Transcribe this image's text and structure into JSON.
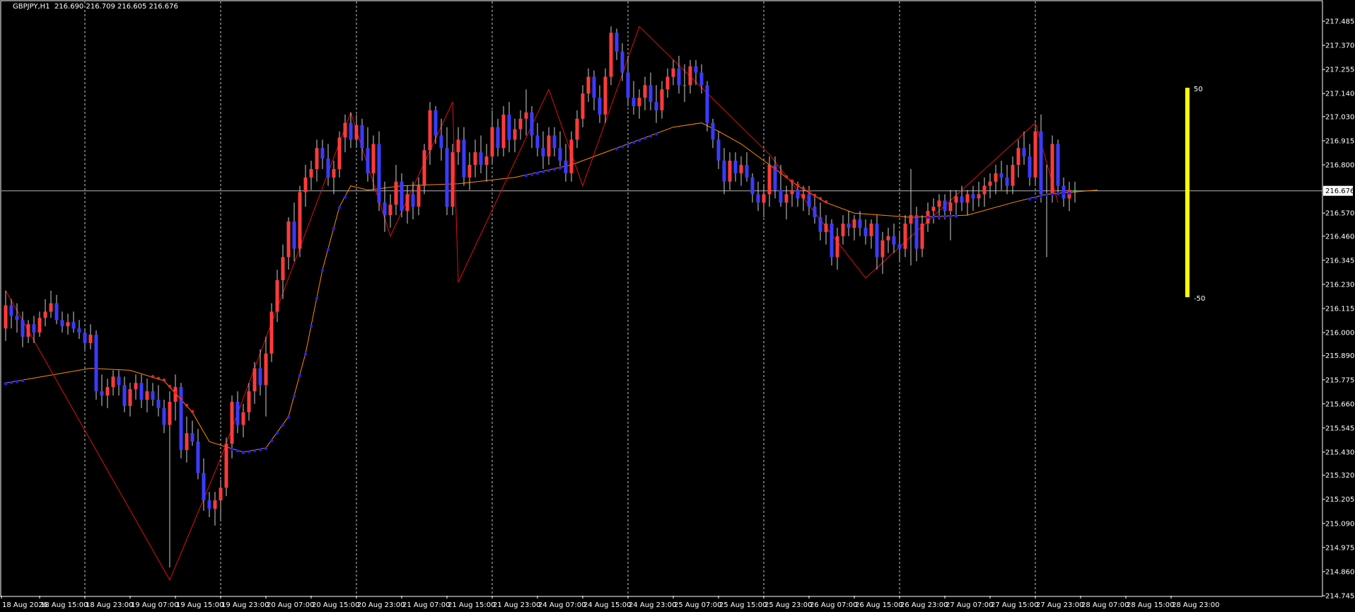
{
  "window": {
    "symbol": "GBPJPY,H1",
    "quote": "216.690 216.709 216.605 216.676"
  },
  "colors": {
    "background": "#000000",
    "foreground": "#ffffff",
    "grid": "#c8c8c8",
    "bull_candle": "#ff3b3b",
    "bear_candle": "#3b3bff",
    "doji_candle": "#00c000",
    "zigzag": "#e01010",
    "ma_line": "#ff8c00",
    "dot_up": "#2020ff",
    "dot_down": "#ff2020",
    "bid_line": "#b4b4b4",
    "gauge": "#ffff00"
  },
  "price_axis": {
    "labels": [
      "217.485",
      "217.370",
      "217.255",
      "217.140",
      "217.030",
      "216.915",
      "216.800",
      "216.570",
      "216.460",
      "216.345",
      "216.230",
      "216.115",
      "216.000",
      "215.890",
      "215.775",
      "215.660",
      "215.545",
      "215.430",
      "215.320",
      "215.205",
      "215.090",
      "214.975",
      "214.860",
      "214.745"
    ],
    "min": 214.745,
    "max": 217.485,
    "current_price": "216.676"
  },
  "time_axis": {
    "labels": [
      "18 Aug 2026",
      "18 Aug 15:00",
      "18 Aug 23:00",
      "19 Aug 07:00",
      "19 Aug 15:00",
      "19 Aug 23:00",
      "20 Aug 07:00",
      "20 Aug 15:00",
      "20 Aug 23:00",
      "21 Aug 07:00",
      "21 Aug 15:00",
      "21 Aug 23:00",
      "24 Aug 07:00",
      "24 Aug 15:00",
      "24 Aug 23:00",
      "25 Aug 07:00",
      "25 Aug 15:00",
      "25 Aug 23:00",
      "26 Aug 07:00",
      "26 Aug 15:00",
      "26 Aug 23:00",
      "27 Aug 07:00",
      "27 Aug 15:00",
      "27 Aug 23:00",
      "28 Aug 07:00",
      "28 Aug 15:00",
      "28 Aug 23:00"
    ]
  },
  "gauge": {
    "top_label": "50",
    "bottom_label": "-50"
  },
  "chart_data": {
    "type": "candlestick",
    "symbol": "GBPJPY",
    "timeframe": "H1",
    "candle_interval": "1h",
    "ohlc": [
      [
        216.02,
        216.2,
        215.96,
        216.13
      ],
      [
        216.13,
        216.16,
        216.02,
        216.08
      ],
      [
        216.08,
        216.14,
        216.0,
        216.06
      ],
      [
        216.06,
        216.1,
        215.93,
        215.98
      ],
      [
        215.98,
        216.06,
        215.95,
        216.04
      ],
      [
        216.04,
        216.08,
        215.95,
        216.0
      ],
      [
        216.0,
        216.1,
        215.98,
        216.07
      ],
      [
        216.07,
        216.16,
        216.03,
        216.1
      ],
      [
        216.1,
        216.2,
        216.07,
        216.14
      ],
      [
        216.14,
        216.18,
        216.04,
        216.06
      ],
      [
        216.06,
        216.1,
        216.0,
        216.03
      ],
      [
        216.03,
        216.09,
        215.99,
        216.05
      ],
      [
        216.05,
        216.1,
        216.0,
        216.02
      ],
      [
        216.02,
        216.06,
        215.97,
        216.0
      ],
      [
        216.0,
        216.02,
        215.92,
        215.95
      ],
      [
        215.95,
        216.04,
        215.92,
        215.99
      ],
      [
        215.99,
        216.01,
        215.68,
        215.72
      ],
      [
        215.72,
        215.8,
        215.65,
        215.7
      ],
      [
        215.7,
        215.78,
        215.64,
        215.74
      ],
      [
        215.74,
        215.82,
        215.7,
        215.79
      ],
      [
        215.79,
        215.82,
        215.7,
        215.75
      ],
      [
        215.75,
        215.79,
        215.62,
        215.65
      ],
      [
        215.65,
        215.76,
        215.6,
        215.73
      ],
      [
        215.73,
        215.8,
        215.68,
        215.76
      ],
      [
        215.76,
        215.8,
        215.64,
        215.68
      ],
      [
        215.68,
        215.78,
        215.62,
        215.72
      ],
      [
        215.72,
        215.76,
        215.65,
        215.68
      ],
      [
        215.68,
        215.75,
        215.6,
        215.64
      ],
      [
        215.64,
        215.68,
        215.52,
        215.56
      ],
      [
        215.56,
        215.72,
        214.88,
        215.67
      ],
      [
        215.67,
        215.8,
        215.58,
        215.74
      ],
      [
        215.74,
        215.76,
        215.4,
        215.44
      ],
      [
        215.44,
        215.6,
        215.38,
        215.52
      ],
      [
        215.52,
        215.58,
        215.46,
        215.48
      ],
      [
        215.48,
        215.54,
        215.3,
        215.33
      ],
      [
        215.33,
        215.4,
        215.15,
        215.2
      ],
      [
        215.2,
        215.24,
        215.12,
        215.16
      ],
      [
        215.16,
        215.24,
        215.08,
        215.2
      ],
      [
        215.2,
        215.3,
        215.1,
        215.26
      ],
      [
        215.26,
        215.5,
        215.22,
        215.47
      ],
      [
        215.47,
        215.7,
        215.4,
        215.67
      ],
      [
        215.67,
        215.72,
        215.52,
        215.56
      ],
      [
        215.56,
        215.66,
        215.5,
        215.62
      ],
      [
        215.62,
        215.76,
        215.58,
        215.72
      ],
      [
        215.72,
        215.86,
        215.66,
        215.83
      ],
      [
        215.83,
        215.92,
        215.7,
        215.75
      ],
      [
        215.75,
        215.98,
        215.6,
        215.9
      ],
      [
        215.9,
        216.14,
        215.86,
        216.1
      ],
      [
        216.1,
        216.3,
        216.05,
        216.25
      ],
      [
        216.25,
        216.42,
        216.16,
        216.36
      ],
      [
        216.36,
        216.55,
        216.3,
        216.53
      ],
      [
        216.53,
        216.62,
        216.34,
        216.4
      ],
      [
        216.4,
        216.7,
        216.36,
        216.67
      ],
      [
        216.67,
        216.8,
        216.6,
        216.74
      ],
      [
        216.74,
        216.82,
        216.68,
        216.78
      ],
      [
        216.78,
        216.92,
        216.72,
        216.88
      ],
      [
        216.88,
        216.92,
        216.78,
        216.83
      ],
      [
        216.83,
        216.9,
        216.7,
        216.74
      ],
      [
        216.74,
        216.82,
        216.66,
        216.78
      ],
      [
        216.78,
        216.96,
        216.74,
        216.93
      ],
      [
        216.93,
        217.04,
        216.86,
        217.0
      ],
      [
        217.0,
        217.05,
        216.88,
        216.92
      ],
      [
        216.92,
        217.04,
        216.88,
        216.99
      ],
      [
        216.99,
        217.02,
        216.82,
        216.88
      ],
      [
        216.88,
        216.98,
        216.72,
        216.76
      ],
      [
        216.76,
        216.94,
        216.68,
        216.9
      ],
      [
        216.9,
        216.96,
        216.58,
        216.62
      ],
      [
        216.62,
        216.72,
        216.48,
        216.56
      ],
      [
        216.56,
        216.66,
        216.5,
        216.61
      ],
      [
        216.61,
        216.8,
        216.56,
        216.72
      ],
      [
        216.72,
        216.76,
        216.55,
        216.58
      ],
      [
        216.58,
        216.7,
        216.52,
        216.66
      ],
      [
        216.66,
        216.72,
        216.54,
        216.6
      ],
      [
        216.6,
        216.74,
        216.56,
        216.7
      ],
      [
        216.7,
        216.9,
        216.66,
        216.87
      ],
      [
        216.87,
        217.1,
        216.8,
        217.06
      ],
      [
        217.06,
        217.08,
        216.9,
        216.94
      ],
      [
        216.94,
        217.02,
        216.82,
        216.88
      ],
      [
        216.88,
        216.98,
        216.56,
        216.6
      ],
      [
        216.6,
        216.9,
        216.56,
        216.86
      ],
      [
        216.86,
        216.98,
        216.8,
        216.92
      ],
      [
        216.92,
        216.98,
        216.7,
        216.74
      ],
      [
        216.74,
        216.86,
        216.68,
        216.8
      ],
      [
        216.8,
        216.92,
        216.74,
        216.86
      ],
      [
        216.86,
        216.94,
        216.76,
        216.8
      ],
      [
        216.8,
        216.9,
        216.72,
        216.84
      ],
      [
        216.84,
        217.06,
        216.8,
        216.98
      ],
      [
        216.98,
        217.02,
        216.84,
        216.88
      ],
      [
        216.88,
        217.08,
        216.84,
        217.04
      ],
      [
        217.04,
        217.1,
        216.86,
        216.92
      ],
      [
        216.92,
        217.02,
        216.86,
        216.97
      ],
      [
        216.97,
        217.06,
        216.92,
        217.02
      ],
      [
        217.02,
        217.16,
        216.94,
        217.05
      ],
      [
        217.05,
        217.08,
        216.88,
        216.94
      ],
      [
        216.94,
        217.0,
        216.84,
        216.88
      ],
      [
        216.88,
        216.96,
        216.78,
        216.84
      ],
      [
        216.84,
        216.98,
        216.8,
        216.94
      ],
      [
        216.94,
        216.98,
        216.84,
        216.88
      ],
      [
        216.88,
        216.96,
        216.78,
        216.82
      ],
      [
        216.82,
        216.9,
        216.72,
        216.76
      ],
      [
        216.76,
        216.96,
        216.72,
        216.92
      ],
      [
        216.92,
        217.06,
        216.88,
        217.02
      ],
      [
        217.02,
        217.18,
        216.98,
        217.14
      ],
      [
        217.14,
        217.26,
        217.1,
        217.22
      ],
      [
        217.22,
        217.25,
        217.06,
        217.12
      ],
      [
        217.12,
        217.18,
        217.0,
        217.04
      ],
      [
        217.04,
        217.26,
        217.0,
        217.22
      ],
      [
        217.22,
        217.46,
        217.18,
        217.43
      ],
      [
        217.43,
        217.45,
        217.3,
        217.34
      ],
      [
        217.34,
        217.38,
        217.2,
        217.24
      ],
      [
        217.24,
        217.32,
        217.08,
        217.12
      ],
      [
        217.12,
        217.2,
        217.04,
        217.08
      ],
      [
        217.08,
        217.16,
        217.02,
        217.12
      ],
      [
        217.12,
        217.22,
        217.06,
        217.18
      ],
      [
        217.18,
        217.24,
        217.06,
        217.1
      ],
      [
        217.1,
        217.18,
        217.0,
        217.06
      ],
      [
        217.06,
        217.2,
        217.02,
        217.16
      ],
      [
        217.16,
        217.26,
        217.12,
        217.22
      ],
      [
        217.22,
        217.3,
        217.18,
        217.26
      ],
      [
        217.26,
        217.32,
        217.14,
        217.18
      ],
      [
        217.18,
        217.28,
        217.1,
        217.18
      ],
      [
        217.18,
        217.3,
        217.14,
        217.27
      ],
      [
        217.27,
        217.3,
        217.18,
        217.24
      ],
      [
        217.24,
        217.28,
        217.14,
        217.18
      ],
      [
        217.18,
        217.2,
        216.96,
        217.0
      ],
      [
        217.0,
        217.02,
        216.88,
        216.92
      ],
      [
        216.92,
        216.96,
        216.78,
        216.82
      ],
      [
        216.82,
        216.88,
        216.66,
        216.72
      ],
      [
        216.72,
        216.86,
        216.68,
        216.82
      ],
      [
        216.82,
        216.86,
        216.72,
        216.76
      ],
      [
        216.76,
        216.84,
        216.7,
        216.8
      ],
      [
        216.8,
        216.86,
        216.72,
        216.74
      ],
      [
        216.74,
        216.76,
        216.62,
        216.66
      ],
      [
        216.66,
        216.72,
        216.58,
        216.62
      ],
      [
        216.62,
        216.7,
        216.55,
        216.66
      ],
      [
        216.66,
        216.84,
        216.6,
        216.8
      ],
      [
        216.8,
        216.84,
        216.64,
        216.68
      ],
      [
        216.68,
        216.8,
        216.6,
        216.62
      ],
      [
        216.62,
        216.7,
        216.54,
        216.66
      ],
      [
        216.66,
        216.72,
        216.6,
        216.68
      ],
      [
        216.68,
        216.72,
        216.6,
        216.64
      ],
      [
        216.64,
        216.7,
        216.58,
        216.66
      ],
      [
        216.66,
        216.7,
        216.56,
        216.6
      ],
      [
        216.6,
        216.66,
        216.52,
        216.55
      ],
      [
        216.55,
        216.62,
        216.44,
        216.48
      ],
      [
        216.48,
        216.56,
        216.42,
        216.52
      ],
      [
        216.52,
        216.54,
        216.32,
        216.36
      ],
      [
        216.36,
        216.5,
        216.3,
        216.46
      ],
      [
        216.46,
        216.56,
        216.42,
        216.52
      ],
      [
        216.52,
        216.58,
        216.46,
        216.5
      ],
      [
        216.5,
        216.56,
        216.44,
        216.54
      ],
      [
        216.54,
        216.58,
        216.46,
        216.5
      ],
      [
        216.5,
        216.54,
        216.42,
        216.46
      ],
      [
        216.46,
        216.54,
        216.4,
        216.52
      ],
      [
        216.52,
        216.56,
        216.3,
        216.36
      ],
      [
        216.36,
        216.48,
        216.28,
        216.44
      ],
      [
        216.44,
        216.5,
        216.38,
        216.46
      ],
      [
        216.46,
        216.52,
        216.38,
        216.42
      ],
      [
        216.42,
        216.48,
        216.34,
        216.4
      ],
      [
        216.4,
        216.56,
        216.36,
        216.52
      ],
      [
        216.52,
        216.78,
        216.32,
        216.56
      ],
      [
        216.56,
        216.6,
        216.34,
        216.4
      ],
      [
        216.4,
        216.56,
        216.36,
        216.52
      ],
      [
        216.52,
        216.62,
        216.48,
        216.58
      ],
      [
        216.58,
        216.64,
        216.52,
        216.6
      ],
      [
        216.6,
        216.66,
        216.54,
        216.63
      ],
      [
        216.63,
        216.66,
        216.54,
        216.58
      ],
      [
        216.58,
        216.68,
        216.44,
        216.62
      ],
      [
        216.62,
        216.68,
        216.56,
        216.65
      ],
      [
        216.65,
        216.7,
        216.58,
        216.62
      ],
      [
        216.62,
        216.68,
        216.56,
        216.66
      ],
      [
        216.66,
        216.7,
        216.58,
        216.64
      ],
      [
        216.64,
        216.72,
        216.6,
        216.66
      ],
      [
        216.66,
        216.74,
        216.6,
        216.7
      ],
      [
        216.7,
        216.76,
        216.64,
        216.72
      ],
      [
        216.72,
        216.8,
        216.66,
        216.76
      ],
      [
        216.76,
        216.82,
        216.68,
        216.74
      ],
      [
        216.74,
        216.8,
        216.66,
        216.7
      ],
      [
        216.7,
        216.84,
        216.66,
        216.8
      ],
      [
        216.8,
        216.92,
        216.74,
        216.88
      ],
      [
        216.88,
        216.96,
        216.8,
        216.84
      ],
      [
        216.84,
        216.9,
        216.7,
        216.74
      ],
      [
        216.74,
        216.98,
        216.7,
        216.96
      ],
      [
        216.96,
        217.04,
        216.62,
        216.66
      ],
      [
        216.66,
        216.8,
        216.36,
        216.66
      ],
      [
        216.66,
        216.94,
        216.62,
        216.9
      ],
      [
        216.9,
        216.92,
        216.66,
        216.7
      ],
      [
        216.7,
        216.74,
        216.6,
        216.64
      ],
      [
        216.64,
        216.72,
        216.58,
        216.68
      ],
      [
        216.68,
        216.72,
        216.62,
        216.68
      ]
    ],
    "moving_average": [
      [
        0,
        215.76
      ],
      [
        15,
        215.83
      ],
      [
        22,
        215.82
      ],
      [
        28,
        215.77
      ],
      [
        33,
        215.62
      ],
      [
        36,
        215.48
      ],
      [
        42,
        215.43
      ],
      [
        46,
        215.45
      ],
      [
        50,
        215.6
      ],
      [
        53,
        215.9
      ],
      [
        56,
        216.3
      ],
      [
        59,
        216.6
      ],
      [
        61,
        216.7
      ],
      [
        64,
        216.68
      ],
      [
        70,
        216.7
      ],
      [
        80,
        216.71
      ],
      [
        90,
        216.74
      ],
      [
        100,
        216.8
      ],
      [
        110,
        216.9
      ],
      [
        118,
        216.98
      ],
      [
        123,
        217.0
      ],
      [
        126,
        216.96
      ],
      [
        130,
        216.9
      ],
      [
        135,
        216.8
      ],
      [
        140,
        216.7
      ],
      [
        145,
        216.62
      ],
      [
        150,
        216.57
      ],
      [
        160,
        216.55
      ],
      [
        170,
        216.56
      ],
      [
        178,
        216.62
      ],
      [
        184,
        216.66
      ],
      [
        193,
        216.68
      ]
    ],
    "zigzag": [
      [
        0,
        216.2
      ],
      [
        29,
        214.82
      ],
      [
        38,
        215.4
      ],
      [
        61,
        217.05
      ],
      [
        68,
        216.46
      ],
      [
        79,
        217.1
      ],
      [
        80,
        216.24
      ],
      [
        96,
        217.16
      ],
      [
        102,
        216.7
      ],
      [
        112,
        217.46
      ],
      [
        135,
        216.85
      ],
      [
        152,
        216.26
      ],
      [
        182,
        217.0
      ],
      [
        186,
        216.62
      ]
    ]
  }
}
